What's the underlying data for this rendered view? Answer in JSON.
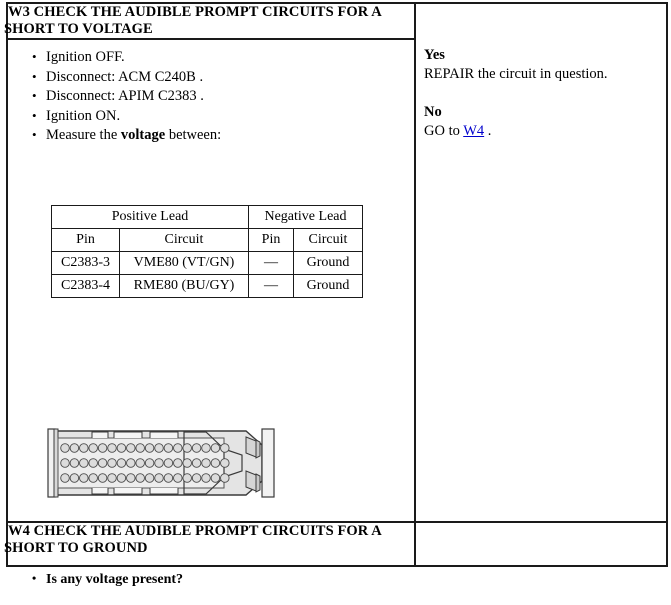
{
  "steps": [
    {
      "id": "W3",
      "title_line1": "W3 CHECK THE AUDIBLE PROMPT CIRCUITS FOR A",
      "title_line2": "SHORT TO VOLTAGE",
      "instructions": [
        {
          "text": "Ignition OFF.",
          "bold_part": ""
        },
        {
          "text": "Disconnect: ACM C240B .",
          "bold_part": ""
        },
        {
          "text": "Disconnect: APIM C2383 .",
          "bold_part": ""
        },
        {
          "text": "Ignition ON.",
          "bold_part": ""
        }
      ],
      "measure_prefix": "Measure the ",
      "measure_bold": "voltage",
      "measure_suffix": " between:",
      "question": "Is any voltage present?",
      "lead_table": {
        "group_headers": [
          "Positive Lead",
          "Negative Lead"
        ],
        "column_headers": [
          "Pin",
          "Circuit",
          "Pin",
          "Circuit"
        ],
        "rows": [
          [
            "C2383-3",
            "VME80 (VT/GN)",
            "—",
            "Ground"
          ],
          [
            "C2383-4",
            "RME80 (BU/GY)",
            "—",
            "Ground"
          ]
        ]
      },
      "answers": {
        "yes_label": "Yes",
        "yes_action": "REPAIR the circuit in question.",
        "no_label": "No",
        "no_prefix": "GO to ",
        "no_link": "W4",
        "no_suffix": " ."
      }
    },
    {
      "id": "W4",
      "title_line1": "W4 CHECK THE AUDIBLE PROMPT CIRCUITS FOR A",
      "title_line2": "SHORT TO GROUND"
    }
  ],
  "connector": {
    "name": "c2383-connector-illustration",
    "pin_rows": 3,
    "pins_per_row": 18,
    "body_color": "#e8e8e8",
    "outline_color": "#3a3a3a"
  },
  "colors": {
    "border": "#1a1a1a",
    "link": "#0000cc",
    "text": "#000000",
    "background": "#ffffff"
  }
}
